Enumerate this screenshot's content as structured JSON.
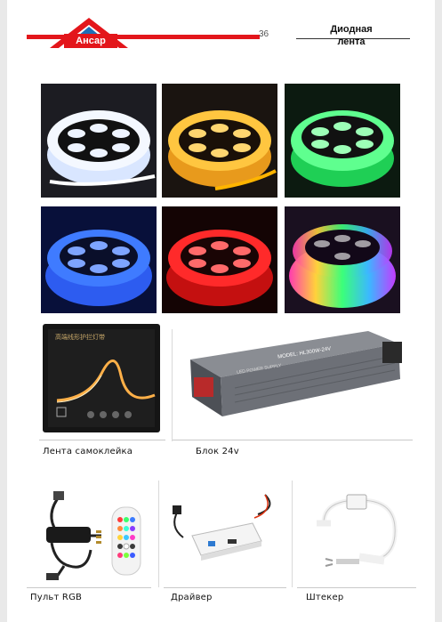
{
  "header": {
    "logo_text": "Ансар",
    "page_number": "36",
    "title_line1": "Диодная",
    "title_line2": "лента"
  },
  "colors": {
    "brand_red": "#e3161b",
    "strip_white": "#eef4ff",
    "strip_yellow": "#ffc640",
    "strip_green": "#5fff8f",
    "strip_blue": "#3f7bff",
    "strip_red": "#ff2a2a"
  },
  "strips": [
    {
      "name": "white-led-strip-reel"
    },
    {
      "name": "yellow-led-strip-reel"
    },
    {
      "name": "green-led-strip-reel"
    },
    {
      "name": "blue-led-strip-reel"
    },
    {
      "name": "red-led-strip-reel"
    },
    {
      "name": "rgb-led-strip-reel"
    }
  ],
  "box_text": "高端线形护拦灯带",
  "psu_label": "MODEL: HL300W-24V",
  "psu_sub": "LED POWER SUPPLY",
  "captions": {
    "tape": "Лента самоклейка",
    "psu": "Блок 24v",
    "remote": "Пульт RGB",
    "driver": "Драйвер",
    "plug": "Штекер"
  }
}
